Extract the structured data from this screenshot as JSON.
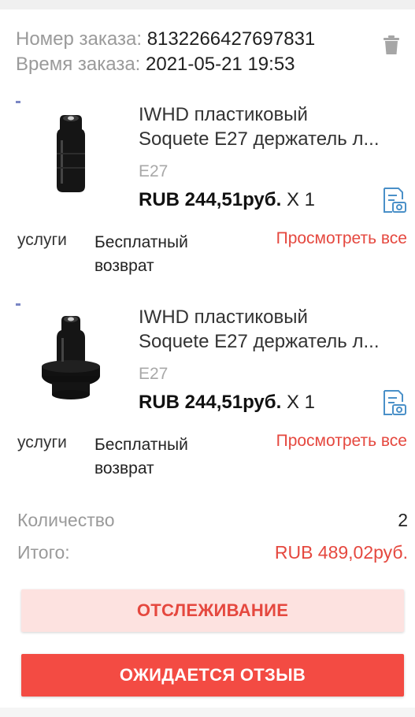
{
  "order": {
    "number_label": "Номер заказа:",
    "number_value": "8132266427697831",
    "time_label": "Время заказа:",
    "time_value": "2021-05-21 19:53"
  },
  "items": [
    {
      "title_line1": "IWHD пластиковый",
      "title_line2": "Soquete E27 держатель л...",
      "variant": "E27",
      "price": "RUB 244,51руб.",
      "qty": "X 1",
      "service_label": "услуги",
      "service_value": "Бесплатный возврат",
      "view_all": "Просмотреть все"
    },
    {
      "title_line1": "IWHD пластиковый",
      "title_line2": "Soquete E27 держатель л...",
      "variant": "E27",
      "price": "RUB 244,51руб.",
      "qty": "X 1",
      "service_label": "услуги",
      "service_value": "Бесплатный возврат",
      "view_all": "Просмотреть все"
    }
  ],
  "summary": {
    "quantity_label": "Количество",
    "quantity_value": "2",
    "total_label": "Итого:",
    "total_value": "RUB 489,02руб."
  },
  "buttons": {
    "track": "ОТСЛЕЖИВАНИЕ",
    "review": "ОЖИДАЕТСЯ ОТЗЫВ"
  },
  "colors": {
    "accent": "#e5483f",
    "button_primary": "#f34b43",
    "button_secondary_bg": "#fde2e0",
    "icon_blue": "#4a90c8"
  }
}
